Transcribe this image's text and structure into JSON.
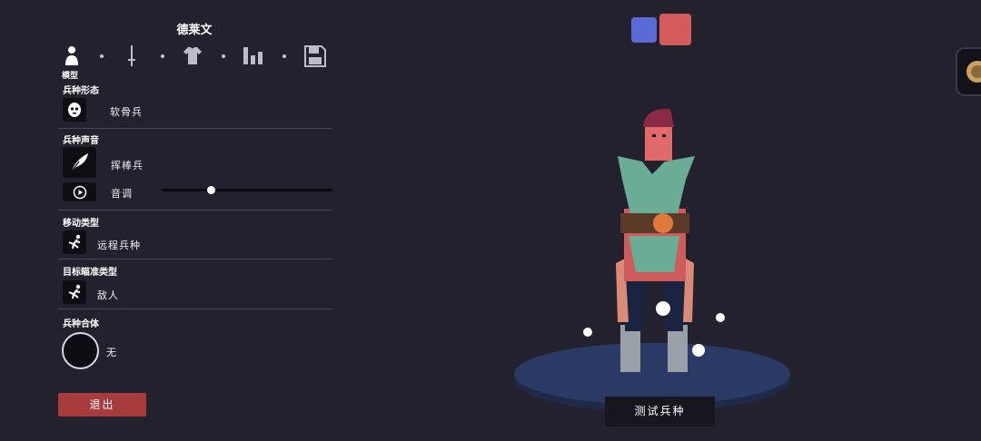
{
  "unit": {
    "name": "德莱文"
  },
  "tabs": {
    "active_label": "模型",
    "items": [
      {
        "icon": "person-icon"
      },
      {
        "icon": "sword-icon"
      },
      {
        "icon": "shirt-icon"
      },
      {
        "icon": "stats-icon"
      },
      {
        "icon": "save-icon"
      }
    ]
  },
  "sections": {
    "form": {
      "title": "兵种形态",
      "value": "软骨兵",
      "icon": "face-icon"
    },
    "voice": {
      "title": "兵种声音",
      "value": "挥棒兵",
      "icon": "quill-icon",
      "pitch_label": "音调",
      "pitch_level": 0.29
    },
    "movement": {
      "title": "移动类型",
      "value": "远程兵种",
      "icon": "stick-figure-icon"
    },
    "targeting": {
      "title": "目标瞄准类型",
      "value": "敌人",
      "icon": "stick-figure-icon"
    },
    "combine": {
      "title": "兵种合体",
      "value": "无"
    }
  },
  "buttons": {
    "exit": "退出",
    "test_unit": "测试兵种"
  },
  "colors": {
    "team_blue": "#5a6bd6",
    "team_red": "#d35b5b",
    "exit_button": "#a83b3b",
    "background": "#22212d"
  }
}
